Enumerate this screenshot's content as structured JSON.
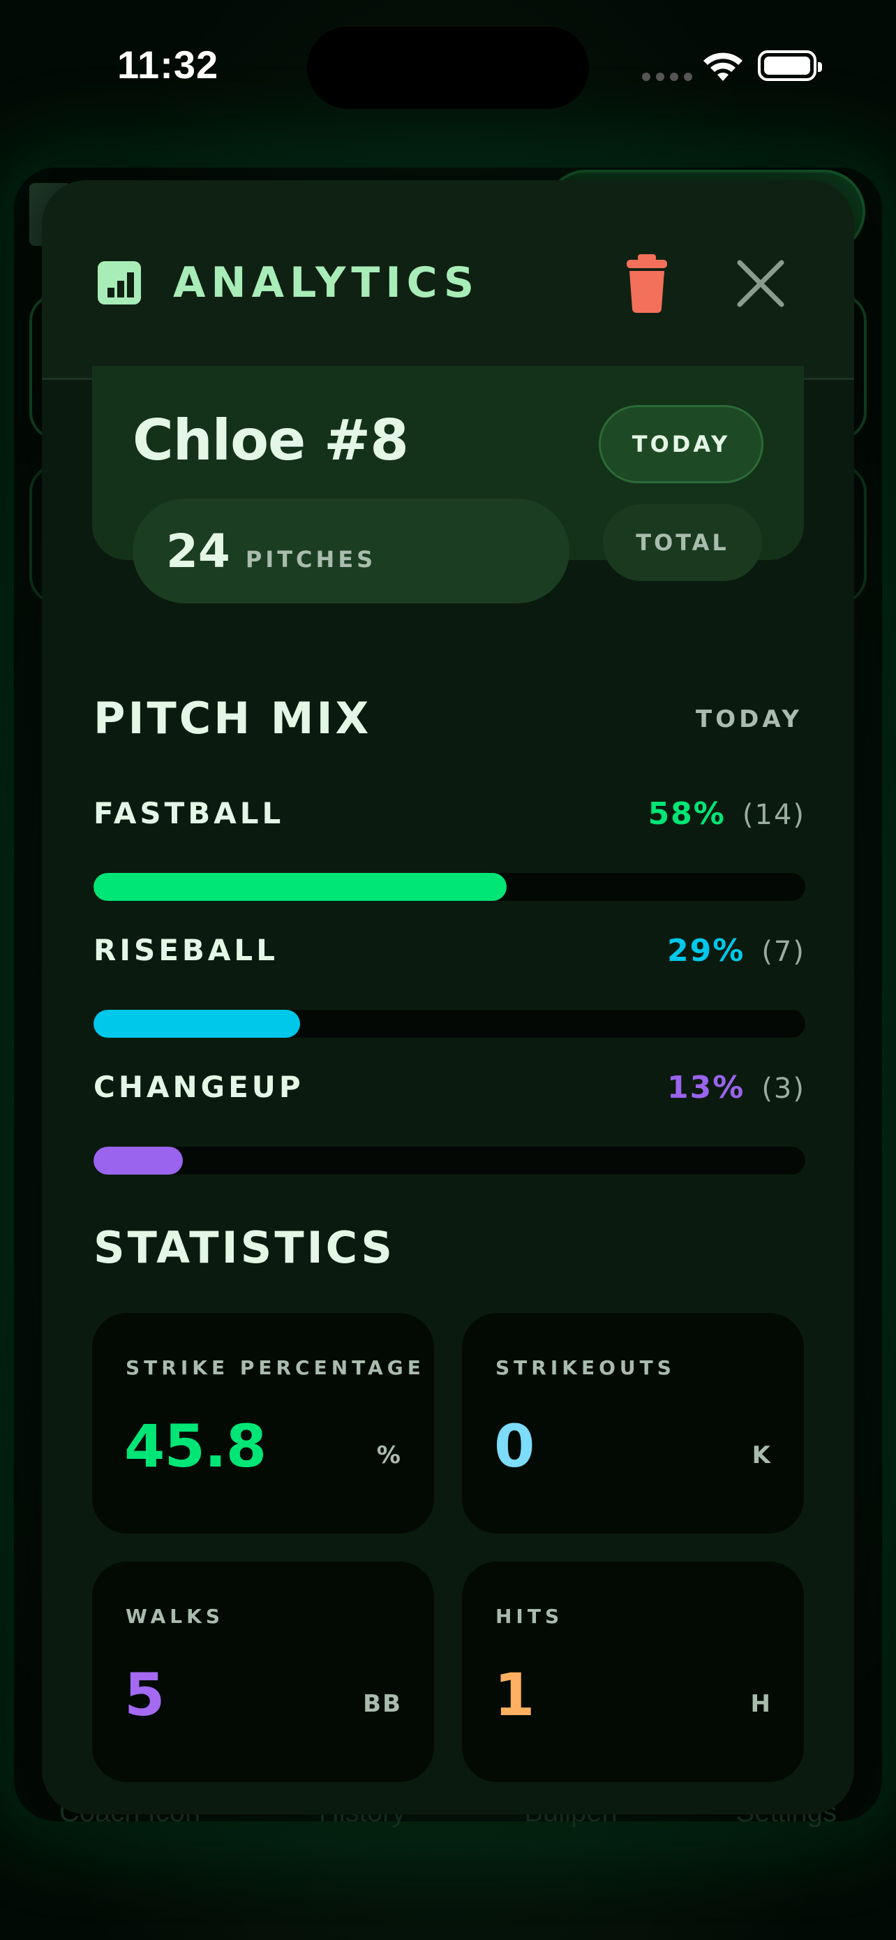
{
  "status_bar": {
    "time": "11:32"
  },
  "background_tabs": [
    "Coach Icon",
    "History",
    "Bullpen",
    "Settings"
  ],
  "header": {
    "title": "ANALYTICS"
  },
  "player": {
    "name": "Chloe #8",
    "pitch_count": "24",
    "pitch_label": "PITCHES",
    "filter_today": "TODAY",
    "filter_total": "TOTAL"
  },
  "pitch_mix": {
    "title": "PITCH MIX",
    "period": "TODAY",
    "items": [
      {
        "label": "FASTBALL",
        "percent": "58%",
        "count": "(14)",
        "fraction": 0.58,
        "color": "#00e676"
      },
      {
        "label": "RISEBALL",
        "percent": "29%",
        "count": "(7)",
        "fraction": 0.29,
        "color": "#00c8ea"
      },
      {
        "label": "CHANGEUP",
        "percent": "13%",
        "count": "(3)",
        "fraction": 0.125,
        "color": "#9a64ee"
      }
    ]
  },
  "statistics": {
    "title": "STATISTICS",
    "cards": [
      {
        "label": "STRIKE PERCENTAGE",
        "value": "45.8",
        "unit": "%",
        "color": "#00e676"
      },
      {
        "label": "STRIKEOUTS",
        "value": "0",
        "unit": "K",
        "color": "#7cdcfa"
      },
      {
        "label": "WALKS",
        "value": "5",
        "unit": "BB",
        "color": "#a46af2"
      },
      {
        "label": "HITS",
        "value": "1",
        "unit": "H",
        "color": "#ffb060"
      }
    ]
  }
}
